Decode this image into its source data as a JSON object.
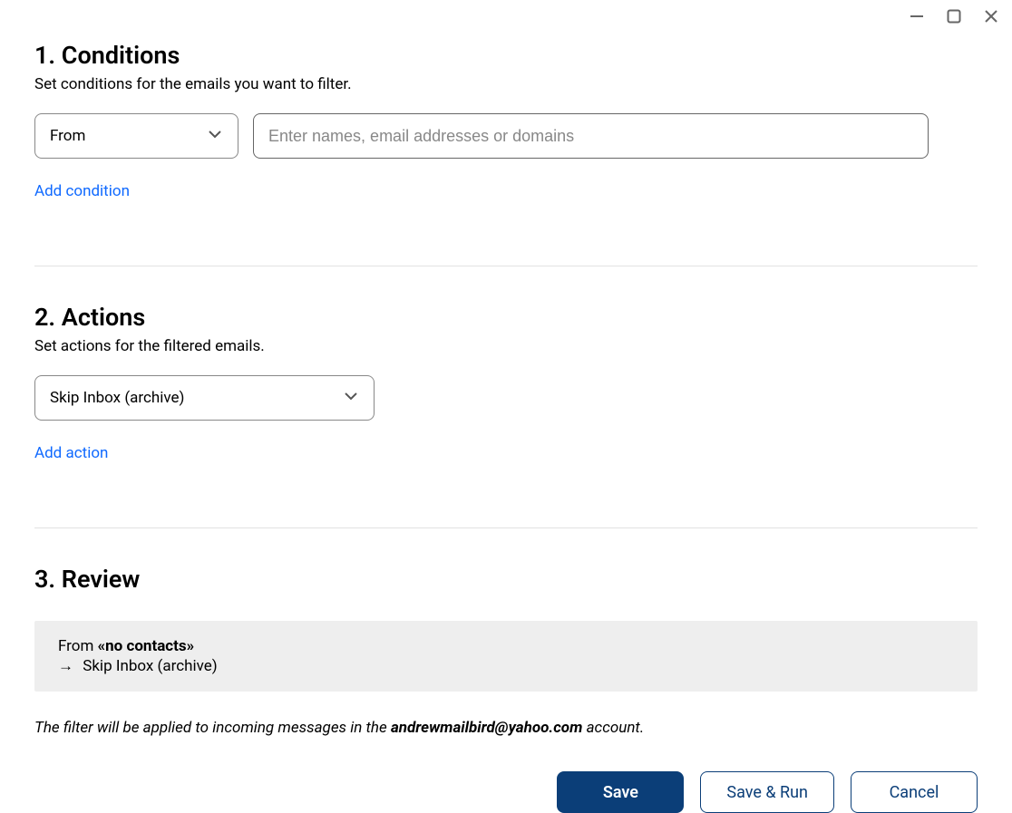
{
  "conditions": {
    "title": "1. Conditions",
    "desc": "Set conditions for the emails you want to filter.",
    "type_selected": "From",
    "value_placeholder": "Enter names, email addresses or domains",
    "add_link": "Add condition"
  },
  "actions": {
    "title": "2. Actions",
    "desc": "Set actions for the filtered emails.",
    "action_selected": "Skip Inbox (archive)",
    "add_link": "Add action"
  },
  "review": {
    "title": "3. Review",
    "from_label": "From ",
    "from_value": "«no contacts»",
    "arrow": "→",
    "action_text": "Skip Inbox (archive)",
    "note_prefix": "The filter will be applied to incoming messages in the ",
    "account": "andrewmailbird@yahoo.com",
    "note_suffix": " account."
  },
  "buttons": {
    "save": "Save",
    "save_run": "Save & Run",
    "cancel": "Cancel"
  }
}
